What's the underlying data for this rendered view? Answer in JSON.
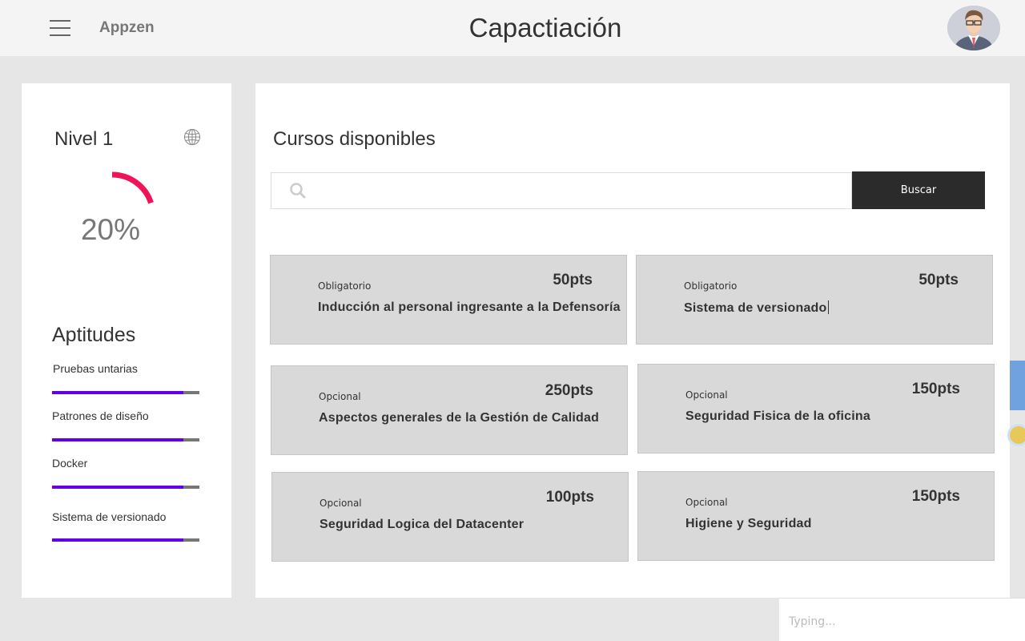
{
  "header": {
    "brand": "Appzen",
    "title": "Capactiación"
  },
  "sidebar": {
    "level_title": "Nivel 1",
    "progress_text": "20%",
    "progress_value": 0.2,
    "skills_title": "Aptitudes",
    "skills": [
      {
        "label": "Pruebas untarias",
        "level": 0.89
      },
      {
        "label": "Patrones de diseño",
        "level": 0.89
      },
      {
        "label": "Docker",
        "level": 0.89
      },
      {
        "label": "Sistema de versionado",
        "level": 0.89
      }
    ]
  },
  "main": {
    "section_title": "Cursos disponibles",
    "search": {
      "placeholder": "",
      "value": "",
      "button_label": "Buscar"
    },
    "courses": [
      {
        "tag": "Obligatorio",
        "title": "Inducción al personal ingresante a la Defensoría",
        "points": "50pts"
      },
      {
        "tag": "Obligatorio",
        "title": "Sistema de versionado",
        "points": "50pts"
      },
      {
        "tag": "Opcional",
        "title": "Aspectos generales de la Gestión de Calidad",
        "points": "250pts"
      },
      {
        "tag": "Opcional",
        "title": "Seguridad Fisica de la oficina",
        "points": "150pts"
      },
      {
        "tag": "Opcional",
        "title": "Seguridad Logica del Datacenter",
        "points": "100pts"
      },
      {
        "tag": "Opcional",
        "title": "Higiene y Seguridad",
        "points": "150pts"
      }
    ]
  },
  "chat": {
    "placeholder": "Typing..."
  },
  "colors": {
    "gauge_arc": "#ef1457",
    "skill_fill": "#6200ea",
    "skill_track": "#777777",
    "button_bg": "#2b2b2b",
    "card_bg": "#d9d9d9"
  },
  "icons": {
    "menu": "hamburger-menu-icon",
    "globe": "globe-icon",
    "search": "search-icon"
  }
}
